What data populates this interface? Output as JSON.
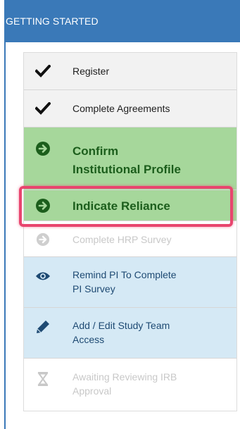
{
  "panel": {
    "header": "GETTING STARTED"
  },
  "steps": [
    {
      "label": "Register",
      "state": "completed",
      "icon": "checkmark-icon"
    },
    {
      "label": "Complete Agreements",
      "state": "completed",
      "icon": "checkmark-icon"
    },
    {
      "label_line1": "Confirm",
      "label_line2": "Institutional Profile",
      "state": "active",
      "icon": "arrow-circle-right-icon"
    },
    {
      "label": "Indicate Reliance",
      "state": "active-highlighted",
      "icon": "arrow-circle-right-icon"
    },
    {
      "label": "Complete HRP Survey",
      "state": "disabled",
      "icon": "arrow-circle-right-icon"
    },
    {
      "label_line1": "Remind PI To Complete",
      "label_line2": "PI Survey",
      "state": "info",
      "icon": "eye-icon"
    },
    {
      "label_line1": "Add / Edit Study Team",
      "label_line2": "Access",
      "state": "info",
      "icon": "pencil-icon"
    },
    {
      "label_line1": "Awaiting Reviewing IRB",
      "label_line2": "Approval",
      "state": "disabled",
      "icon": "hourglass-icon"
    }
  ],
  "colors": {
    "header_bg": "#3a79b8",
    "active_bg": "#a6d79b",
    "active_text": "#1c5e1c",
    "info_bg": "#d5e9f5",
    "highlight_border": "#e8456e",
    "disabled_text": "#c8c8c8"
  }
}
